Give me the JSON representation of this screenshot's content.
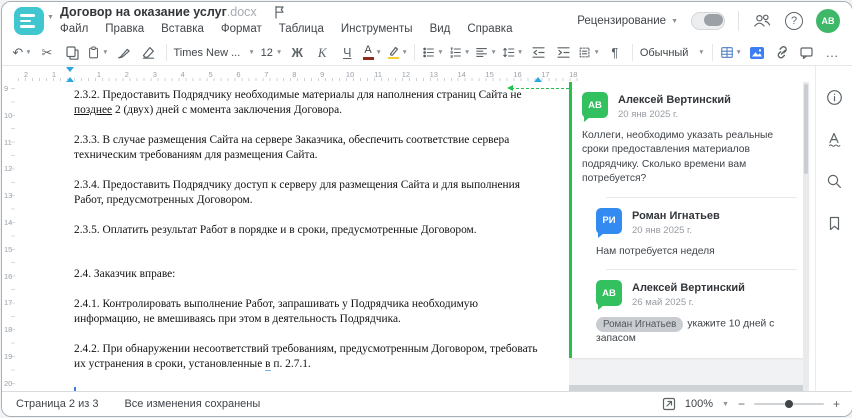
{
  "header": {
    "title": "Договор на оказание услуг",
    "title_ext": ".docx",
    "menu": [
      "Файл",
      "Правка",
      "Вставка",
      "Формат",
      "Таблица",
      "Инструменты",
      "Вид",
      "Справка"
    ],
    "review_label": "Рецензирование",
    "help_glyph": "?",
    "avatar_initials": "АВ"
  },
  "toolbar": {
    "undo_glyph": "↶",
    "cut_glyph": "✂",
    "font_name": "Times New ...",
    "font_size": "12",
    "bold_label": "Ж",
    "italic_label": "К",
    "underline_label": "Ч",
    "color_letter": "А",
    "pilcrow": "¶",
    "style_name": "Обычный",
    "more_glyph": "…"
  },
  "ruler": {
    "left_numbers": [
      "2",
      "1"
    ],
    "numbers": [
      "1",
      "2",
      "3",
      "4",
      "5",
      "6",
      "7",
      "8",
      "9",
      "10",
      "11",
      "12",
      "13",
      "14",
      "15",
      "16",
      "17",
      "18"
    ],
    "vertical_numbers": [
      "9",
      "10",
      "11",
      "12",
      "13",
      "14",
      "15",
      "16",
      "17",
      "18",
      "19",
      "20"
    ]
  },
  "document": {
    "paragraphs": [
      {
        "segments": [
          {
            "t": "2.3.2. Предоставить Подрядчику необходимые материалы для наполнения страниц Сайта не "
          },
          {
            "t": "позднее",
            "u": true
          },
          {
            "t": " 2 (двух) дней с момента заключения Договора."
          }
        ]
      },
      {
        "segments": [
          {
            "t": "2.3.3. В случае размещения Сайта на сервере Заказчика, обеспечить соответствие сервера техническим требованиям для размещения Сайта."
          }
        ]
      },
      {
        "segments": [
          {
            "t": "2.3.4. Предоставить Подрядчику доступ к серверу для размещения Сайта и для выполнения Работ, предусмотренных Договором."
          }
        ]
      },
      {
        "segments": [
          {
            "t": "2.3.5. Оплатить результат Работ в порядке и в сроки, предусмотренные Договором."
          }
        ]
      },
      {
        "segments": [
          {
            "t": "2.4. Заказчик вправе:"
          }
        ]
      },
      {
        "segments": [
          {
            "t": "2.4.1. Контролировать выполнение Работ, запрашивать у Подрядчика необходимую информацию, не вмешиваясь при этом в деятельность Подрядчика."
          }
        ]
      },
      {
        "segments": [
          {
            "t": "2.4.2. При обнаружении несоответствий требованиям, предусмотренным Договором, требовать их устранения в сроки, установленные "
          },
          {
            "t": "в",
            "sp": true
          },
          {
            "t": " п. 2.7.1."
          }
        ]
      }
    ]
  },
  "comments": {
    "thread": [
      {
        "initials": "АВ",
        "color": "green",
        "name": "Алексей Вертинский",
        "date": "20 янв 2025 г.",
        "text": "Коллеги, необходимо указать реальные сроки предоставления материалов подрядчику. Сколько времени вам потребуется?",
        "reply": false
      },
      {
        "initials": "РИ",
        "color": "blue",
        "name": "Роман Игнатьев",
        "date": "20 янв 2025 г.",
        "text": "Нам потребуется неделя",
        "reply": true
      },
      {
        "initials": "АВ",
        "color": "green",
        "name": "Алексей Вертинский",
        "date": "26 май 2025 г.",
        "mention": "Роман Игнатьев",
        "text": "укажите 10 дней с запасом",
        "reply": true
      }
    ]
  },
  "statusbar": {
    "page_info": "Страница 2 из 3",
    "save_status": "Все изменения сохранены",
    "zoom_value": "100%",
    "zoom_out": "−",
    "zoom_in": "+"
  }
}
